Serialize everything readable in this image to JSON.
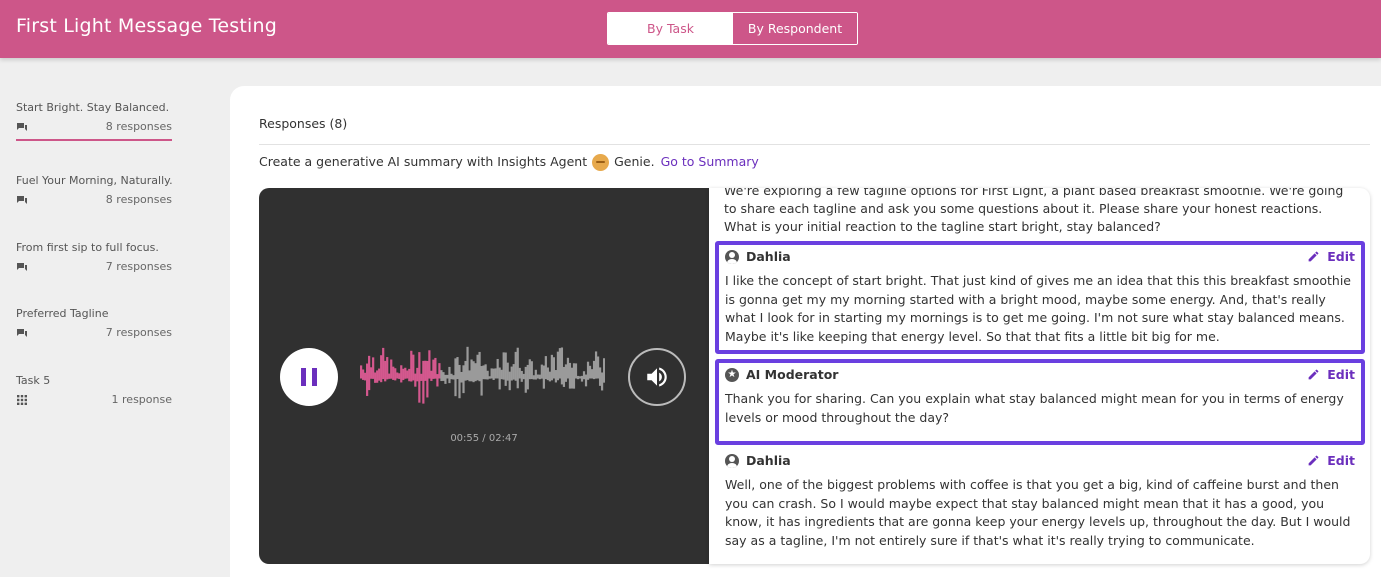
{
  "header": {
    "title": "First Light Message Testing",
    "toggle": {
      "by_task": "By Task",
      "by_respondent": "By Respondent"
    }
  },
  "sidebar": {
    "tasks": [
      {
        "name": "Start Bright. Stay Balanced.",
        "count": "8 responses",
        "icon": "chat-icon",
        "active": true
      },
      {
        "name": "Fuel Your Morning, Naturally.",
        "count": "8 responses",
        "icon": "chat-icon"
      },
      {
        "name": "From first sip to full focus.",
        "count": "7 responses",
        "icon": "chat-icon"
      },
      {
        "name": "Preferred Tagline",
        "count": "7 responses",
        "icon": "chat-icon"
      },
      {
        "name": "Task 5",
        "count": "1 response",
        "icon": "grid-icon"
      }
    ]
  },
  "main": {
    "responses_header": "Responses (8)",
    "ai_summary": {
      "prefix": "Create a generative AI summary with Insights Agent",
      "genie": "Genie.",
      "link": "Go to Summary"
    }
  },
  "player": {
    "time": "00:55 / 02:47",
    "progress": 0.33,
    "played_color": "#d4588e",
    "unplayed_color": "#9a9a9a"
  },
  "transcript": {
    "intro": "We're exploring a few tagline options for First Light, a plant based breakfast smoothie. We're going to share each tagline and ask you some questions about it. Please share your honest reactions. What is your initial reaction to the tagline start bright, stay balanced?",
    "edit_label": "Edit",
    "messages": [
      {
        "speaker": "Dahlia",
        "icon": "person-icon",
        "text": "I like the concept of start bright. That just kind of gives me an idea that this this breakfast smoothie is gonna get my my morning started with a bright mood, maybe some energy. And, that's really what I look for in starting my mornings is to get me going. I'm not sure what stay balanced means. Maybe it's like keeping that energy level. So that that fits a little bit big for me."
      },
      {
        "speaker": "AI Moderator",
        "icon": "star-icon",
        "text": "Thank you for sharing. Can you explain what stay balanced might mean for you in terms of energy levels or mood throughout the day?"
      },
      {
        "speaker": "Dahlia",
        "icon": "person-icon",
        "text": "Well, one of the biggest problems with coffee is that you get a big, kind of caffeine burst and then you can crash. So I would maybe expect that stay balanced might mean that it has a good, you know, it has ingredients that are gonna keep your energy levels up, throughout the day. But I would say as a tagline, I'm not entirely sure if that's what it's really trying to communicate."
      }
    ]
  }
}
